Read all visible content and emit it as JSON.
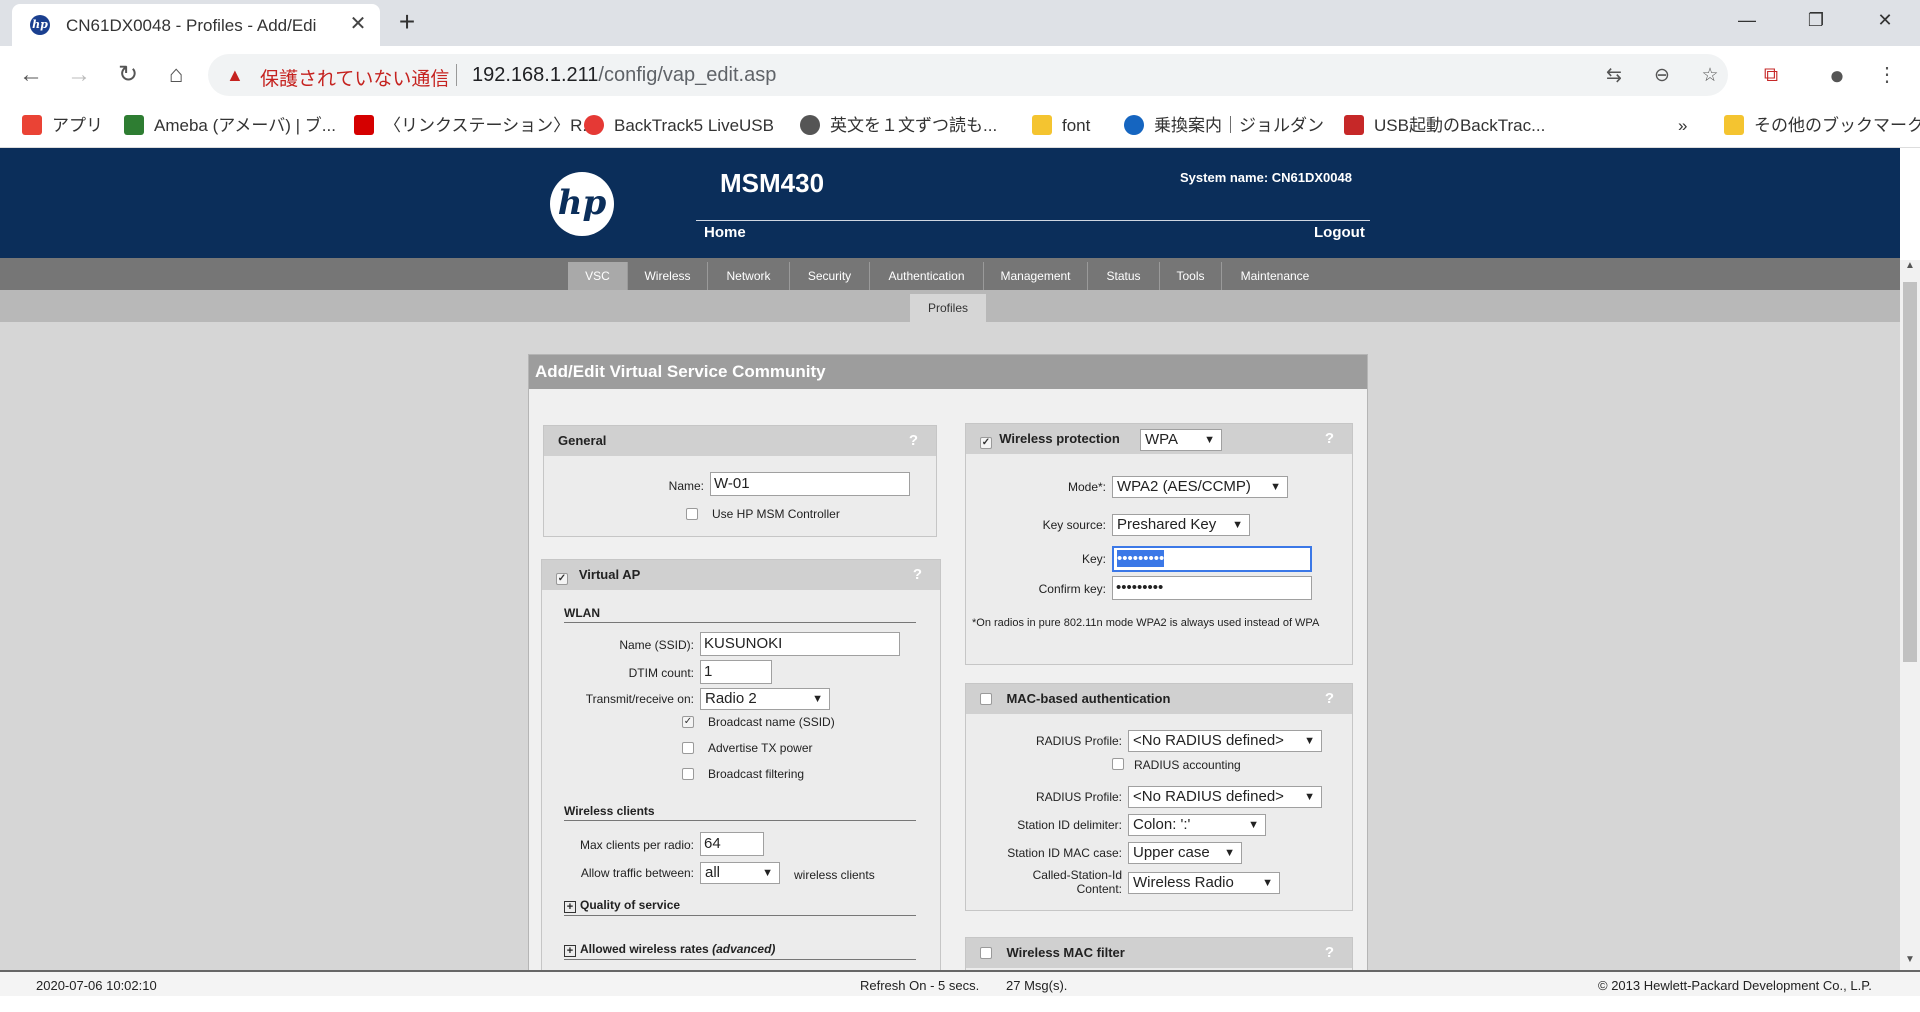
{
  "browser": {
    "tab_title": "CN61DX0048 - Profiles - Add/Edi",
    "tab_close": "✕",
    "new_tab": "+",
    "window_controls": [
      "—",
      "❐",
      "✕"
    ],
    "insecure_label": "保護されていない通信",
    "url_host": "192.168.1.211",
    "url_path": "/config/vap_edit.asp",
    "bookmarks": [
      {
        "label": "アプリ",
        "icon": "apps-grid-icon",
        "color": "#ea4335"
      },
      {
        "label": "Ameba (アメーバ) | ブ...",
        "icon": "ameba-icon",
        "color": "#2e7d32"
      },
      {
        "label": "〈リンクステーション〉R...",
        "icon": "buffalo-icon",
        "color": "#d50000"
      },
      {
        "label": "BackTrack5 LiveUSB",
        "icon": "music-icon",
        "color": "#e53935"
      },
      {
        "label": "英文を１文ずつ読も...",
        "icon": "globe-icon",
        "color": "#555555"
      },
      {
        "label": "font",
        "icon": "folder-icon",
        "color": "#f4c430"
      },
      {
        "label": "乗換案内｜ジョルダン",
        "icon": "jorudan-icon",
        "color": "#1565c0"
      },
      {
        "label": "USB起動のBackTrac...",
        "icon": "backtrack-icon",
        "color": "#c62828"
      }
    ],
    "bookmarks_more": "»",
    "other_bookmarks": "その他のブックマーク"
  },
  "header": {
    "logo_text": "hp",
    "product": "MSM430",
    "system_name": "System name: CN61DX0048",
    "home": "Home",
    "logout": "Logout"
  },
  "menu": [
    "VSC",
    "Wireless",
    "Network",
    "Security",
    "Authentication",
    "Management",
    "Status",
    "Tools",
    "Maintenance"
  ],
  "submenu": "Profiles",
  "panel_title": "Add/Edit Virtual Service Community",
  "general": {
    "title": "General",
    "help": "?",
    "name_label": "Name:",
    "name_value": "W-01",
    "use_msm_label": "Use HP MSM Controller"
  },
  "virtual_ap": {
    "title": "Virtual AP",
    "help": "?",
    "wlan_heading": "WLAN",
    "ssid_label": "Name (SSID):",
    "ssid_value": "KUSUNOKI",
    "dtim_label": "DTIM count:",
    "dtim_value": "1",
    "txrx_label": "Transmit/receive on:",
    "txrx_value": "Radio 2",
    "broadcast_name": "Broadcast name (SSID)",
    "advertise_tx": "Advertise TX power",
    "broadcast_filtering": "Broadcast filtering",
    "clients_heading": "Wireless clients",
    "max_clients_label": "Max clients per radio:",
    "max_clients_value": "64",
    "allow_traffic_label": "Allow traffic between:",
    "allow_traffic_value": "all",
    "allow_traffic_suffix": "wireless clients",
    "qos": "Quality of service",
    "rates": "Allowed wireless rates",
    "rates_suffix": "(advanced)"
  },
  "wireless_protection": {
    "title": "Wireless protection",
    "help": "?",
    "type_value": "WPA",
    "mode_label": "Mode*:",
    "mode_value": "WPA2 (AES/CCMP)",
    "key_source_label": "Key source:",
    "key_source_value": "Preshared Key",
    "key_label": "Key:",
    "key_value": "•••••••••",
    "confirm_label": "Confirm key:",
    "confirm_value": "•••••••••",
    "note": "*On radios in pure 802.11n mode WPA2 is always used instead of WPA"
  },
  "mac_auth": {
    "title": "MAC-based authentication",
    "help": "?",
    "radius_profile_label": "RADIUS Profile:",
    "radius_profile_value": "<No RADIUS defined>",
    "radius_accounting": "RADIUS accounting",
    "radius_profile2_label": "RADIUS Profile:",
    "radius_profile2_value": "<No RADIUS defined>",
    "station_delim_label": "Station ID delimiter:",
    "station_delim_value": "Colon: ':'",
    "mac_case_label": "Station ID MAC case:",
    "mac_case_value": "Upper case",
    "called_station_label1": "Called-Station-Id",
    "called_station_label2": "Content:",
    "called_station_value": "Wireless Radio"
  },
  "mac_filter": {
    "title": "Wireless MAC filter",
    "help": "?"
  },
  "status_bar": {
    "datetime": "2020-07-06 10:02:10",
    "refresh": "Refresh On - 5 secs.",
    "messages": "27 Msg(s).",
    "copyright": "© 2013 Hewlett-Packard Development Co., L.P."
  }
}
